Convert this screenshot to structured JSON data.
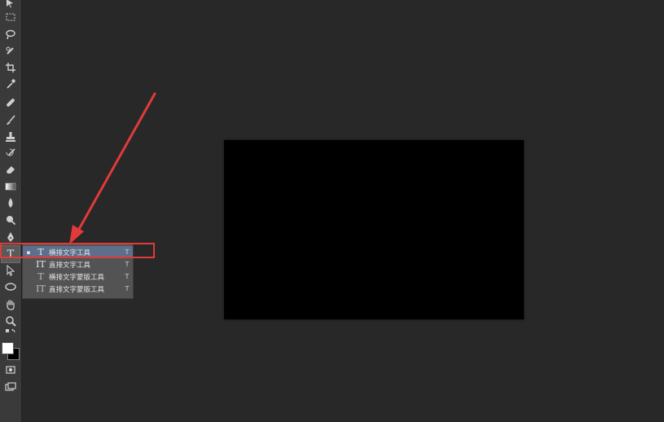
{
  "colors": {
    "workspace": "#282828",
    "toolbar": "#3a3a3a",
    "canvas": "#000000",
    "flyout_bg": "#535353",
    "flyout_selected": "#5d6f8a",
    "annotation": "#e23a3a",
    "foreground_swatch": "#ffffff",
    "background_swatch": "#000000"
  },
  "toolbar": {
    "active_tool": "type-tool",
    "type_tool_glyph": "T",
    "tools": [
      "move-icon",
      "marquee-icon",
      "lasso-icon",
      "quick-select-icon",
      "crop-icon",
      "eyedropper-icon",
      "healing-brush-icon",
      "brush-icon",
      "clone-stamp-icon",
      "history-brush-icon",
      "eraser-icon",
      "gradient-icon",
      "blur-icon",
      "dodge-icon",
      "pen-icon",
      "type-icon",
      "path-select-icon",
      "ellipse-icon",
      "hand-icon",
      "zoom-icon"
    ]
  },
  "flyout": {
    "items": [
      {
        "glyph": "T",
        "label": "横排文字工具",
        "shortcut": "T",
        "selected": true,
        "marker": "▪"
      },
      {
        "glyph": "IT",
        "label": "直排文字工具",
        "shortcut": "T",
        "selected": false,
        "marker": ""
      },
      {
        "glyph": "T",
        "label": "横排文字蒙版工具",
        "shortcut": "T",
        "selected": false,
        "marker": ""
      },
      {
        "glyph": "IT",
        "label": "直排文字蒙版工具",
        "shortcut": "T",
        "selected": false,
        "marker": ""
      }
    ]
  }
}
